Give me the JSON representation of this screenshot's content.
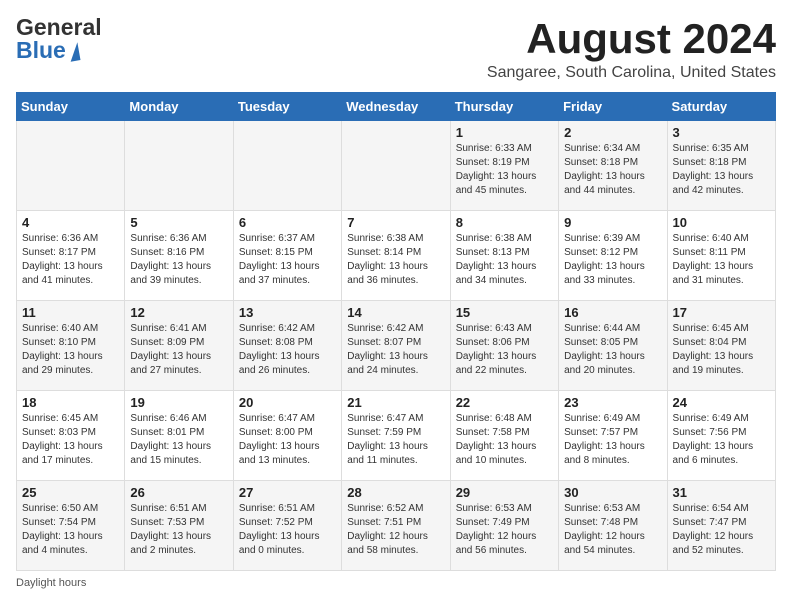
{
  "header": {
    "logo_general": "General",
    "logo_blue": "Blue",
    "title": "August 2024",
    "subtitle": "Sangaree, South Carolina, United States"
  },
  "days_of_week": [
    "Sunday",
    "Monday",
    "Tuesday",
    "Wednesday",
    "Thursday",
    "Friday",
    "Saturday"
  ],
  "weeks": [
    [
      {
        "day": "",
        "content": ""
      },
      {
        "day": "",
        "content": ""
      },
      {
        "day": "",
        "content": ""
      },
      {
        "day": "",
        "content": ""
      },
      {
        "day": "1",
        "content": "Sunrise: 6:33 AM\nSunset: 8:19 PM\nDaylight: 13 hours and 45 minutes."
      },
      {
        "day": "2",
        "content": "Sunrise: 6:34 AM\nSunset: 8:18 PM\nDaylight: 13 hours and 44 minutes."
      },
      {
        "day": "3",
        "content": "Sunrise: 6:35 AM\nSunset: 8:18 PM\nDaylight: 13 hours and 42 minutes."
      }
    ],
    [
      {
        "day": "4",
        "content": "Sunrise: 6:36 AM\nSunset: 8:17 PM\nDaylight: 13 hours and 41 minutes."
      },
      {
        "day": "5",
        "content": "Sunrise: 6:36 AM\nSunset: 8:16 PM\nDaylight: 13 hours and 39 minutes."
      },
      {
        "day": "6",
        "content": "Sunrise: 6:37 AM\nSunset: 8:15 PM\nDaylight: 13 hours and 37 minutes."
      },
      {
        "day": "7",
        "content": "Sunrise: 6:38 AM\nSunset: 8:14 PM\nDaylight: 13 hours and 36 minutes."
      },
      {
        "day": "8",
        "content": "Sunrise: 6:38 AM\nSunset: 8:13 PM\nDaylight: 13 hours and 34 minutes."
      },
      {
        "day": "9",
        "content": "Sunrise: 6:39 AM\nSunset: 8:12 PM\nDaylight: 13 hours and 33 minutes."
      },
      {
        "day": "10",
        "content": "Sunrise: 6:40 AM\nSunset: 8:11 PM\nDaylight: 13 hours and 31 minutes."
      }
    ],
    [
      {
        "day": "11",
        "content": "Sunrise: 6:40 AM\nSunset: 8:10 PM\nDaylight: 13 hours and 29 minutes."
      },
      {
        "day": "12",
        "content": "Sunrise: 6:41 AM\nSunset: 8:09 PM\nDaylight: 13 hours and 27 minutes."
      },
      {
        "day": "13",
        "content": "Sunrise: 6:42 AM\nSunset: 8:08 PM\nDaylight: 13 hours and 26 minutes."
      },
      {
        "day": "14",
        "content": "Sunrise: 6:42 AM\nSunset: 8:07 PM\nDaylight: 13 hours and 24 minutes."
      },
      {
        "day": "15",
        "content": "Sunrise: 6:43 AM\nSunset: 8:06 PM\nDaylight: 13 hours and 22 minutes."
      },
      {
        "day": "16",
        "content": "Sunrise: 6:44 AM\nSunset: 8:05 PM\nDaylight: 13 hours and 20 minutes."
      },
      {
        "day": "17",
        "content": "Sunrise: 6:45 AM\nSunset: 8:04 PM\nDaylight: 13 hours and 19 minutes."
      }
    ],
    [
      {
        "day": "18",
        "content": "Sunrise: 6:45 AM\nSunset: 8:03 PM\nDaylight: 13 hours and 17 minutes."
      },
      {
        "day": "19",
        "content": "Sunrise: 6:46 AM\nSunset: 8:01 PM\nDaylight: 13 hours and 15 minutes."
      },
      {
        "day": "20",
        "content": "Sunrise: 6:47 AM\nSunset: 8:00 PM\nDaylight: 13 hours and 13 minutes."
      },
      {
        "day": "21",
        "content": "Sunrise: 6:47 AM\nSunset: 7:59 PM\nDaylight: 13 hours and 11 minutes."
      },
      {
        "day": "22",
        "content": "Sunrise: 6:48 AM\nSunset: 7:58 PM\nDaylight: 13 hours and 10 minutes."
      },
      {
        "day": "23",
        "content": "Sunrise: 6:49 AM\nSunset: 7:57 PM\nDaylight: 13 hours and 8 minutes."
      },
      {
        "day": "24",
        "content": "Sunrise: 6:49 AM\nSunset: 7:56 PM\nDaylight: 13 hours and 6 minutes."
      }
    ],
    [
      {
        "day": "25",
        "content": "Sunrise: 6:50 AM\nSunset: 7:54 PM\nDaylight: 13 hours and 4 minutes."
      },
      {
        "day": "26",
        "content": "Sunrise: 6:51 AM\nSunset: 7:53 PM\nDaylight: 13 hours and 2 minutes."
      },
      {
        "day": "27",
        "content": "Sunrise: 6:51 AM\nSunset: 7:52 PM\nDaylight: 13 hours and 0 minutes."
      },
      {
        "day": "28",
        "content": "Sunrise: 6:52 AM\nSunset: 7:51 PM\nDaylight: 12 hours and 58 minutes."
      },
      {
        "day": "29",
        "content": "Sunrise: 6:53 AM\nSunset: 7:49 PM\nDaylight: 12 hours and 56 minutes."
      },
      {
        "day": "30",
        "content": "Sunrise: 6:53 AM\nSunset: 7:48 PM\nDaylight: 12 hours and 54 minutes."
      },
      {
        "day": "31",
        "content": "Sunrise: 6:54 AM\nSunset: 7:47 PM\nDaylight: 12 hours and 52 minutes."
      }
    ]
  ],
  "footer": {
    "note": "Daylight hours"
  }
}
